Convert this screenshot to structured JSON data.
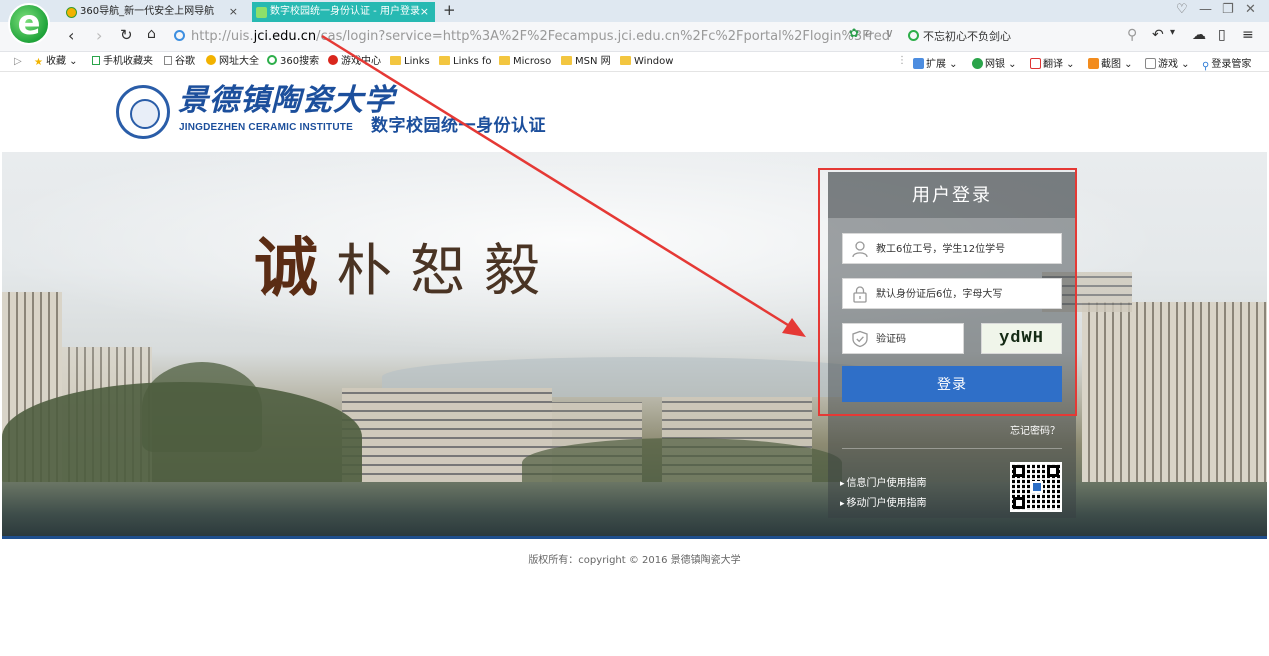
{
  "browser": {
    "tabs": [
      {
        "title": "360导航_新一代安全上网导航",
        "active": false
      },
      {
        "title": "数字校园统一身份认证 - 用户登录",
        "active": true
      }
    ],
    "new_tab": "+",
    "url_prefix": "http://uis.",
    "url_domain": "jci.edu.cn",
    "url_rest": "/cas/login?service=http%3A%2F%2Fecampus.jci.edu.cn%2Fc%2Fportal%2Flogin%3Fredir",
    "search_text": "不忘初心不负剑心",
    "active_tab_color": "#27b9b2"
  },
  "bookmarks": {
    "left": [
      {
        "label": "收藏",
        "icon": "star-icon"
      },
      {
        "label": "手机收藏夹",
        "icon": "phone-icon"
      },
      {
        "label": "谷歌",
        "icon": "page-icon"
      },
      {
        "label": "网址大全",
        "icon": "globe-icon"
      },
      {
        "label": "360搜索",
        "icon": "search-icon"
      },
      {
        "label": "游戏中心",
        "icon": "game-icon"
      },
      {
        "label": "Links",
        "icon": "folder-icon"
      },
      {
        "label": "Links fo",
        "icon": "folder-icon"
      },
      {
        "label": "Microso",
        "icon": "folder-icon"
      },
      {
        "label": "MSN 网",
        "icon": "folder-icon"
      },
      {
        "label": "Window",
        "icon": "folder-icon"
      }
    ],
    "right": [
      {
        "label": "扩展",
        "icon": "extension-icon"
      },
      {
        "label": "网银",
        "icon": "bank-icon"
      },
      {
        "label": "翻译",
        "icon": "translate-icon"
      },
      {
        "label": "截图",
        "icon": "screenshot-icon"
      },
      {
        "label": "游戏",
        "icon": "game-icon"
      },
      {
        "label": "登录管家",
        "icon": "key-icon"
      }
    ]
  },
  "header": {
    "school_name_cn": "景德镇陶瓷大学",
    "school_name_en": "JINGDEZHEN CERAMIC INSTITUTE",
    "system_title": "数字校园统一身份认证"
  },
  "banner": {
    "motto": "诚朴恕毅"
  },
  "login": {
    "title": "用户登录",
    "username_placeholder": "教工6位工号，学生12位学号",
    "password_placeholder": "默认身份证后6位，字母大写",
    "captcha_placeholder": "验证码",
    "captcha_text": "ydWH",
    "submit_label": "登录",
    "forgot_label": "忘记密码？",
    "guides": [
      "信息门户使用指南",
      "移动门户使用指南"
    ],
    "button_color": "#2f6fc8"
  },
  "footer": {
    "copyright": "版权所有：copyright © 2016 景德镇陶瓷大学"
  }
}
